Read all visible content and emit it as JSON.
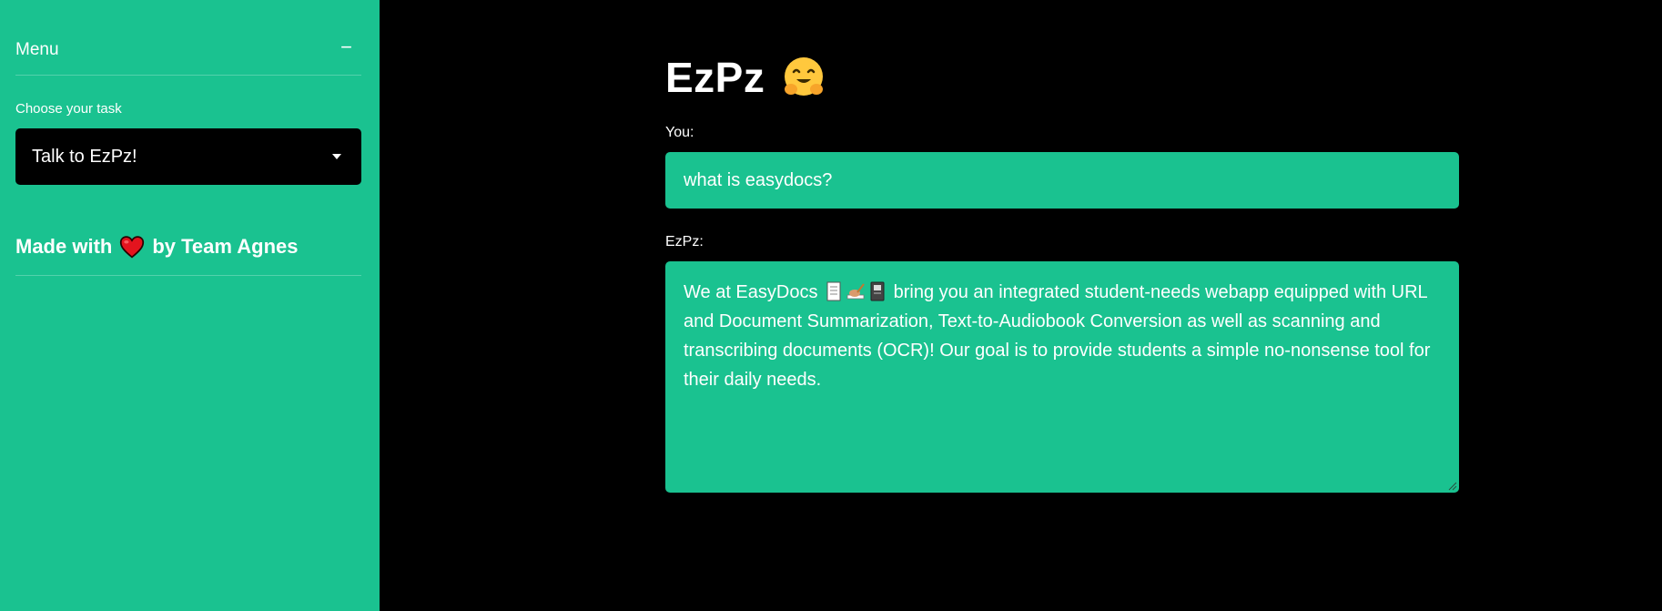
{
  "sidebar": {
    "menu_title": "Menu",
    "collapse_symbol": "−",
    "task_label": "Choose your task",
    "task_selected": "Talk to EzPz!",
    "credit_prefix": "Made with",
    "credit_suffix": "by Team Agnes"
  },
  "main": {
    "title": "EzPz",
    "you_label": "You:",
    "you_value": "what is easydocs?",
    "bot_label": "EzPz:",
    "response_part1": "We at EasyDocs",
    "response_part2": " bring you an integrated student-needs webapp equipped with URL and Document Summarization, Text-to-Audiobook Conversion as well as scanning and transcribing documents (OCR)! Our goal is to provide students a simple no-nonsense tool for their daily needs."
  },
  "theme": {
    "accent": "#1ac290",
    "background": "#000000",
    "text": "#ffffff"
  }
}
